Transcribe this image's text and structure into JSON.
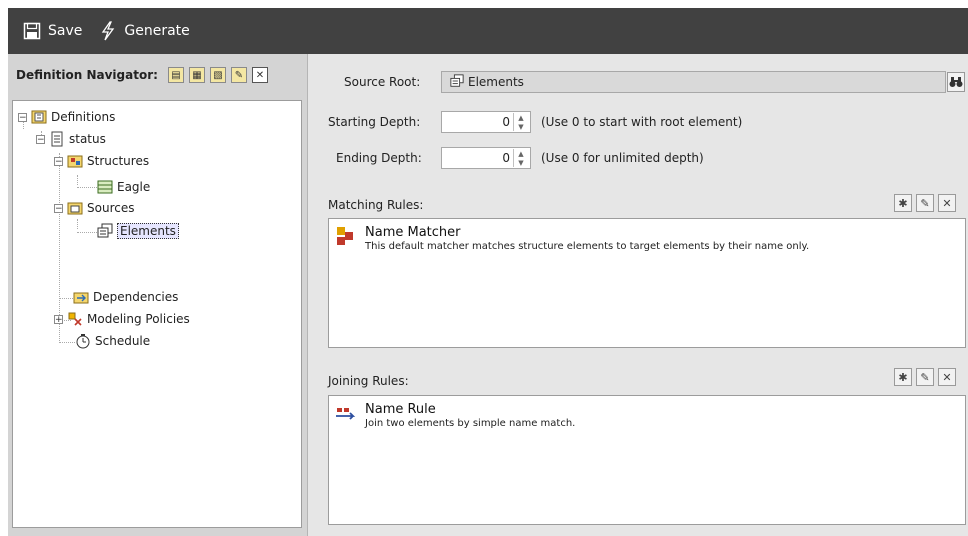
{
  "toolbar": {
    "save_label": "Save",
    "generate_label": "Generate"
  },
  "navigator": {
    "title": "Definition Navigator:",
    "tree": {
      "definitions": "Definitions",
      "status": "status",
      "structures": "Structures",
      "eagle": "Eagle",
      "sources": "Sources",
      "elements": "Elements",
      "dependencies": "Dependencies",
      "modeling_policies": "Modeling Policies",
      "schedule": "Schedule"
    }
  },
  "form": {
    "source_root_label": "Source Root:",
    "source_root_value": "Elements",
    "starting_depth_label": "Starting Depth:",
    "starting_depth_value": "0",
    "starting_depth_hint": "(Use 0 to start with root element)",
    "ending_depth_label": "Ending Depth:",
    "ending_depth_value": "0",
    "ending_depth_hint": "(Use 0 for unlimited depth)"
  },
  "matching": {
    "label": "Matching Rules:",
    "rule_title": "Name Matcher",
    "rule_desc": "This default matcher matches structure elements to target elements by their name only."
  },
  "joining": {
    "label": "Joining Rules:",
    "rule_title": "Name Rule",
    "rule_desc": "Join two elements by simple name match."
  },
  "colors": {
    "toolbar_bg": "#414141",
    "navigator_bg": "#d4d4d4",
    "content_bg": "#e6e6e6"
  }
}
